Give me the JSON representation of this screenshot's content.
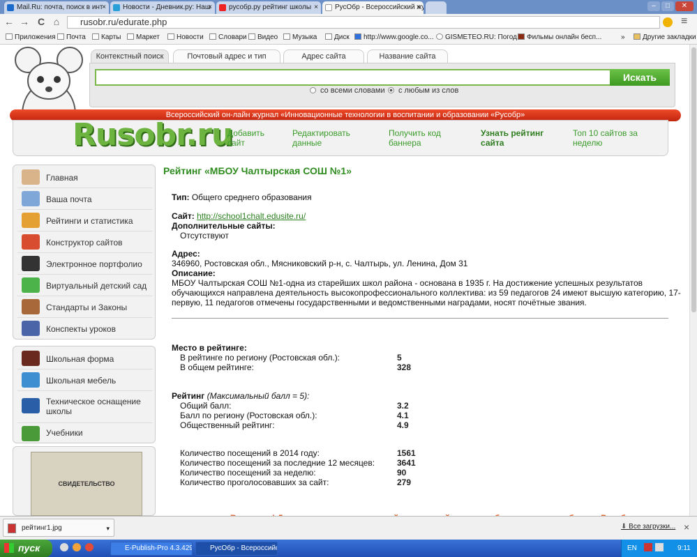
{
  "browser": {
    "tabs": [
      {
        "label": "Mail.Ru: почта, поиск в инт",
        "color": "#1a6bcc"
      },
      {
        "label": "Новости - Дневник.ру: Наш",
        "color": "#2b9fd8"
      },
      {
        "label": "русобр.ру рейтинг школы",
        "color": "#e22"
      },
      {
        "label": "РусОбр - Всероссийский жу",
        "color": "#3a8a2a"
      }
    ],
    "tab_close": "×",
    "window_buttons": [
      "–",
      "□",
      "✕"
    ],
    "nav_icons": [
      "←",
      "→",
      "C",
      "⌂"
    ],
    "url": "rusobr.ru/edurate.php",
    "bookmarks": [
      "Приложения",
      "Почта",
      "Карты",
      "Маркет",
      "Новости",
      "Словари",
      "Видео",
      "Музыка",
      "Диск",
      "http://www.google.co...",
      "GISMETEO.RU: Погод...",
      "Фильмы онлайн бесп...",
      "»",
      "Другие закладки"
    ]
  },
  "search": {
    "tabs": [
      "Контекстный поиск",
      "Почтовый адрес и тип",
      "Адрес сайта",
      "Название сайта"
    ],
    "button": "Искать",
    "options": [
      "со всеми словами",
      "с любым из слов"
    ],
    "selected_option": "с любым из слов"
  },
  "banner": "Всероссийский он-лайн журнал «Инновационные технологии в воспитании и образовании «Русобр»",
  "logo": "Rusobr.ru",
  "top_links": [
    {
      "line1": "Добавить",
      "line2": "сайт"
    },
    {
      "line1": "Редактировать",
      "line2": "данные"
    },
    {
      "line1": "Получить код",
      "line2": "баннера"
    },
    {
      "line1": "Узнать рейтинг",
      "line2": "сайта"
    },
    {
      "line1": "Топ 10 сайтов за",
      "line2": "неделю"
    }
  ],
  "sidebar1": [
    "Главная",
    "Ваша почта",
    "Рейтинги и статистика",
    "Конструктор сайтов",
    "Электронное портфолио",
    "Виртуальный детский сад",
    "Стандарты и Законы",
    "Конспекты уроков"
  ],
  "sidebar2": [
    {
      "line1": "Школьная форма",
      "line2": ""
    },
    {
      "line1": "Школьная мебель",
      "line2": ""
    },
    {
      "line1": "Техническое оснащение",
      "line2": "школы"
    },
    {
      "line1": "Учебники",
      "line2": ""
    }
  ],
  "certificate": "СВИДЕТЕЛЬСТВО",
  "content": {
    "title": "Рейтинг «МБОУ Чалтырская СОШ №1»",
    "type_label": "Тип:",
    "type_value": "Общего среднего образования",
    "site_label": "Сайт:",
    "site_value": "http://school1chalt.edusite.ru/",
    "extra_label": "Дополнительные сайты:",
    "extra_value": "Отсутствуют",
    "address_label": "Адрес:",
    "address_value": "346960, Ростовская обл., Мясниковский р-н, с. Чалтырь, ул. Ленина, Дом 31",
    "desc_label": "Описание:",
    "desc_lines": [
      "МБОУ Чалтырская СОШ №1-одна из старейших школ района - основана в 1935 г. На достижение успешных результатов",
      "обучающихся направлена деятельность высокопрофессионального коллектива: из 59 педагогов 24 имеют высшую категорию, 17-",
      "первую, 11 педагогов отмечены государственными и ведомственными наградами, носят почётные звания."
    ],
    "place_label": "Место в рейтинге:",
    "place_rows": [
      {
        "label": "В рейтинге по региону (Ростовская обл.):",
        "value": "5"
      },
      {
        "label": "В общем рейтинге:",
        "value": "328"
      }
    ],
    "rating_label": "Рейтинг",
    "rating_note": "(Максимальный балл = 5):",
    "rating_rows": [
      {
        "label": "Общий балл:",
        "value": "3.2"
      },
      {
        "label": "Балл по региону (Ростовская обл.):",
        "value": "4.1"
      },
      {
        "label": "Общественный рейтинг:",
        "value": "4.9"
      }
    ],
    "visit_rows": [
      {
        "label": "Количество посещений в 2014 году:",
        "value": "1561"
      },
      {
        "label": "Количество посещений за последние 12 месяцев:",
        "value": "3641"
      },
      {
        "label": "Количество посещений за неделю:",
        "value": "90"
      },
      {
        "label": "Количество проголосовавших за сайт:",
        "value": "279"
      }
    ],
    "notice": "Внимание! Для корректного расчета рейтинга на сайте должен быть установлен баннер Русобр"
  },
  "downloads": {
    "file": "рейтинг1.jpg",
    "all": "Все загрузки...",
    "close": "×"
  },
  "taskbar": {
    "start": "пуск",
    "tasks": [
      "E-Publish-Pro 4.3.429....",
      "РусОбр - Всероссийс..."
    ],
    "lang": "EN",
    "time": "9:11"
  }
}
